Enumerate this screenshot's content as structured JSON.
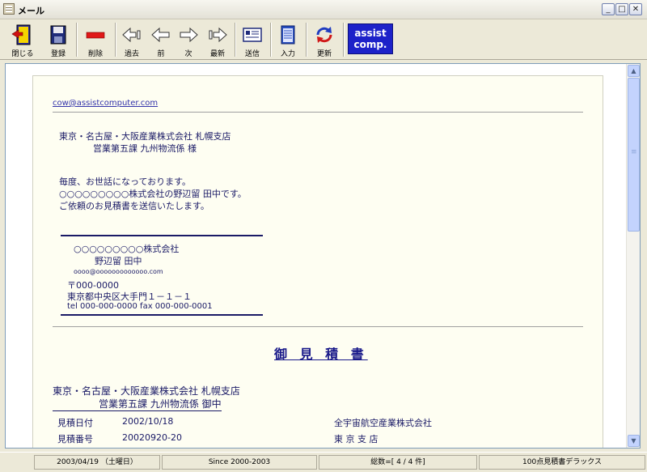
{
  "window": {
    "title": "メール"
  },
  "toolbar": {
    "close": "閉じる",
    "register": "登録",
    "delete": "削除",
    "past": "過去",
    "prev": "前",
    "next": "次",
    "latest": "最新",
    "send": "送信",
    "input": "入力",
    "refresh": "更新",
    "logo_line1": "assist",
    "logo_line2": "comp."
  },
  "mail": {
    "from_email": "cow@assistcomputer.com",
    "to_line1": "東京・名古屋・大阪産業株式会社  札幌支店",
    "to_line2": "営業第五課  九州物流係   様",
    "body_line1": "毎度、お世話になっております。",
    "body_line2": "○○○○○○○○○株式会社の野辺留  田中です。",
    "body_line3": "ご依頼のお見積書を送信いたします。",
    "sig_company": "○○○○○○○○○株式会社",
    "sig_name": "野辺留  田中",
    "sig_email": "oooo@ooooooooooooo.com",
    "sig_zip": "〒000-0000",
    "sig_address": "東京都中央区大手門１－１－１",
    "sig_tel": "tel 000-000-0000 fax 000-000-0001"
  },
  "quote": {
    "title": "御 見 積 書",
    "client_line1": "東京・名古屋・大阪産業株式会社  札幌支店",
    "client_line2": "営業第五課  九州物流係  御中",
    "date_label": "見積日付",
    "date_value": "2002/10/18",
    "number_label": "見積番号",
    "number_value": "20020920-20",
    "issuer_company": "全宇宙航空産業株式会社",
    "issuer_branch": "東 京 支 店"
  },
  "status": {
    "date": "2003/04/19 （土曜日）",
    "since": "Since 2000-2003",
    "count": "総数=[ 4 / 4 件]",
    "product": "100点見積書デラックス"
  }
}
